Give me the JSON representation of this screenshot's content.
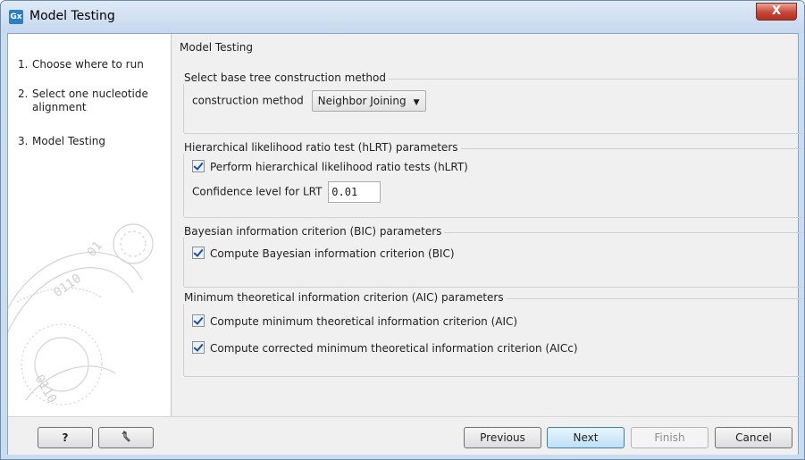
{
  "window": {
    "title": "Model Testing",
    "app_icon_text": "Gx",
    "close_glyph": "X"
  },
  "steps": [
    {
      "num": "1.",
      "label": "Choose where to run"
    },
    {
      "num": "2.",
      "label": "Select one nucleotide alignment"
    },
    {
      "num": "3.",
      "label": "Model Testing"
    }
  ],
  "main": {
    "title": "Model Testing",
    "groups": {
      "base_tree": {
        "title": "Select base tree construction method",
        "method_label": "construction method",
        "method_value": "Neighbor Joining"
      },
      "hlrt": {
        "title": "Hierarchical likelihood ratio test (hLRT) parameters",
        "perform_label": "Perform hierarchical likelihood ratio tests (hLRT)",
        "perform_checked": true,
        "confidence_label": "Confidence level for LRT",
        "confidence_value": "0.01"
      },
      "bic": {
        "title": "Bayesian information criterion (BIC) parameters",
        "compute_label": "Compute Bayesian information criterion (BIC)",
        "compute_checked": true
      },
      "aic": {
        "title": "Minimum theoretical information criterion (AIC) parameters",
        "aic_label": "Compute minimum theoretical information criterion (AIC)",
        "aic_checked": true,
        "aicc_label": "Compute corrected minimum theoretical information criterion (AICc)",
        "aicc_checked": true
      }
    }
  },
  "buttons": {
    "help": "?",
    "previous": "Previous",
    "next": "Next",
    "finish": "Finish",
    "cancel": "Cancel"
  },
  "icons": {
    "reset": "reset-arrow-icon",
    "help": "question-icon",
    "app": "clc-workbench-icon"
  },
  "colors": {
    "title_bar": "#c6d8ee",
    "close": "#c7453a",
    "primary_button": "#bfe0f7"
  }
}
